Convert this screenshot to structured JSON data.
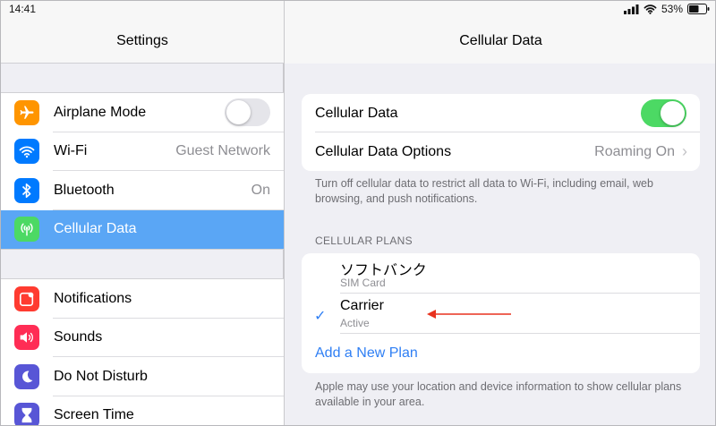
{
  "status_bar": {
    "time": "14:41",
    "battery": "53%"
  },
  "sidebar": {
    "title": "Settings",
    "groups": [
      {
        "items": [
          {
            "label": "Airplane Mode",
            "icon": "airplane-icon",
            "color": "#ff9500",
            "toggle": "off"
          },
          {
            "label": "Wi-Fi",
            "value": "Guest Network",
            "icon": "wifi-icon",
            "color": "#007aff"
          },
          {
            "label": "Bluetooth",
            "value": "On",
            "icon": "bluetooth-icon",
            "color": "#007aff"
          },
          {
            "label": "Cellular Data",
            "icon": "antenna-icon",
            "color": "#4cd964",
            "selected": true
          }
        ]
      },
      {
        "items": [
          {
            "label": "Notifications",
            "icon": "notifications-icon",
            "color": "#ff3b30"
          },
          {
            "label": "Sounds",
            "icon": "speaker-icon",
            "color": "#ff2d55"
          },
          {
            "label": "Do Not Disturb",
            "icon": "moon-icon",
            "color": "#5856d6"
          },
          {
            "label": "Screen Time",
            "icon": "hourglass-icon",
            "color": "#5856d6"
          }
        ]
      }
    ]
  },
  "main": {
    "title": "Cellular Data",
    "cellular_data_label": "Cellular Data",
    "cellular_data_toggle": "on",
    "options_label": "Cellular Data Options",
    "options_value": "Roaming On",
    "footnote_1": "Turn off cellular data to restrict all data to Wi-Fi, including email, web browsing, and push notifications.",
    "plans_header": "CELLULAR PLANS",
    "plans": [
      {
        "name": "ソフトバンク",
        "sub": "SIM Card",
        "checked": false
      },
      {
        "name": "Carrier",
        "sub": "Active",
        "checked": true
      }
    ],
    "add_plan_label": "Add a New Plan",
    "footnote_2": "Apple may use your location and device information to show cellular plans available in your area.",
    "accent_color": "#2f7ff4",
    "annotation_arrow_color": "#e8321e"
  }
}
